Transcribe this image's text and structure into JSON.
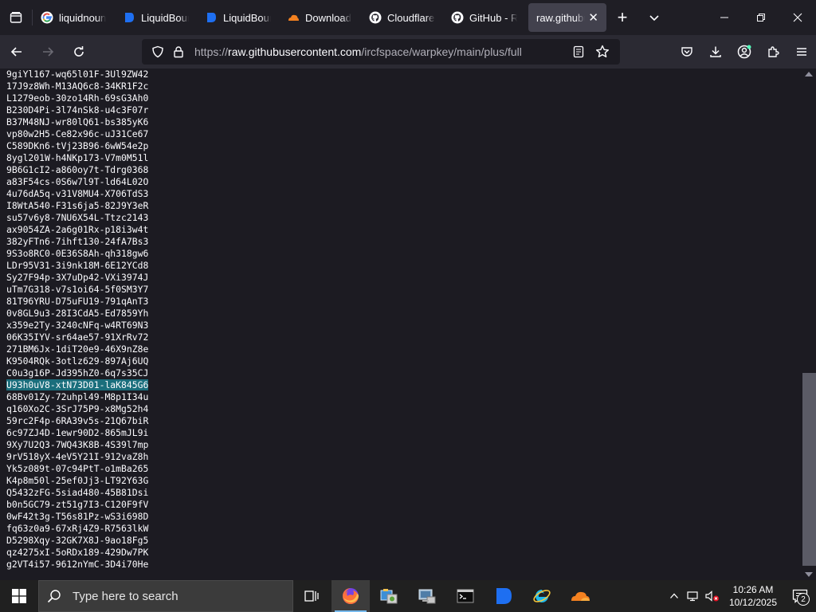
{
  "browser": {
    "tabs": [
      {
        "label": "liquidnoun",
        "icon": "google-icon",
        "active": false
      },
      {
        "label": "LiquidBoun",
        "icon": "liquidbounce-icon",
        "active": false
      },
      {
        "label": "LiquidBoun",
        "icon": "liquidbounce-icon",
        "active": false
      },
      {
        "label": "Download",
        "icon": "cloudflare-icon",
        "active": false
      },
      {
        "label": "Cloudflare-",
        "icon": "github-icon",
        "active": false
      },
      {
        "label": "GitHub - R",
        "icon": "github-icon",
        "active": false
      },
      {
        "label": "raw.githubu",
        "icon": "",
        "active": true
      }
    ],
    "url": {
      "proto": "https://",
      "host": "raw.githubusercontent.com",
      "path": "/ircfspace/warpkey/main/plus/full"
    }
  },
  "content": {
    "lines": [
      "9giYl167-wq65l01F-3Ul9ZW42",
      "17J9z8Wh-M13AQ6c8-34KR1F2c",
      "L1279eob-30zo14Rh-69sG3Ah0",
      "B230D4Pi-3l74nSk8-u4c3F07r",
      "B37M48NJ-wr80lQ61-bs385yK6",
      "vp80w2H5-Ce82x96c-uJ31Ce67",
      "C589DKn6-tVj23B96-6wW54e2p",
      "8ygl201W-h4NKp173-V7m0M51l",
      "9B6G1cI2-a860oy7t-Tdrg0368",
      "a83F54cs-0S6w7l9T-ld64L02O",
      "4u76dA5q-v31V8MU4-X706TdS3",
      "I8WtA540-F31s6ja5-82J9Y3eR",
      "su57v6y8-7NU6X54L-Ttzc2143",
      "ax9054ZA-2a6g01Rx-p18i3w4t",
      "382yFTn6-7ihft130-24fA7Bs3",
      "9S3o8RC0-0E36S8Ah-qh318gw6",
      "LDr95V31-3i9nk18M-6E12YCd8",
      "Sy27F94p-3X7uDp42-VXi3974J",
      "uTm7G318-v7s1oi64-5f0SM3Y7",
      "81T96YRU-D75uFU19-791qAnT3",
      "0v8GL9u3-28I3CdA5-Ed7859Yh",
      "x359e2Ty-3240cNFq-w4RT69N3",
      "06K35IYV-sr64ae57-91XrRv72",
      "271BM6Jx-1diT20e9-46X9nZ8e",
      "K9504RQk-3otlz629-897Aj6UQ",
      "C0u3g16P-Jd395hZ0-6q7s35CJ",
      "U93h0uV8-xtN73D01-laK845G6",
      "68Bv01Zy-72uhpl49-M8p1I34u",
      "q160Xo2C-3SrJ75P9-x8Mg52h4",
      "59rc2F4p-6RA39v5s-21Q67biR",
      "6c97ZJ4D-1ewr90D2-865mJL9i",
      "9Xy7U2Q3-7WQ43K8B-4S39l7mp",
      "9rV518yX-4eV5Y21I-912vaZ8h",
      "Yk5z089t-07c94PtT-o1mBa265",
      "K4p8m50l-25ef0Jj3-LT92Y63G",
      "Q5432zFG-5siad480-45B81Dsi",
      "b0n5GC79-zt51g7I3-C120F9fV",
      "0wF42t3g-T56s81Pz-wS3i698D",
      "fq63z0a9-67xRj4Z9-R7563lkW",
      "D5298Xqy-32GK7X8J-9ao18Fg5",
      "qz4275xI-5oRDx189-429Dw7PK",
      "g2VT4i57-9612nYmC-3D4i70He"
    ],
    "selected_line_index": 26
  },
  "taskbar": {
    "search_placeholder": "Type here to search",
    "apps": [
      "firefox-icon",
      "control-panel-icon",
      "computer-management-icon",
      "terminal-icon",
      "liquidbounce-icon",
      "internet-explorer-icon",
      "cloudflare-warp-icon"
    ],
    "time": "10:26 AM",
    "date": "10/12/2025",
    "notification_count": "2"
  }
}
